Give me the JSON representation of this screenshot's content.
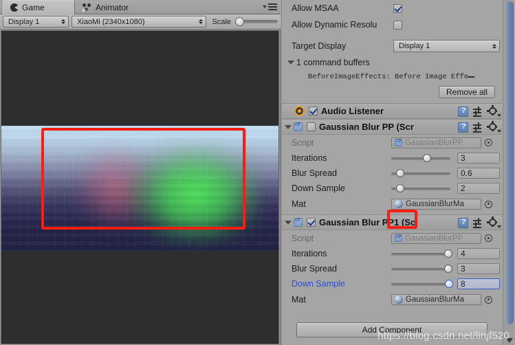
{
  "game_view": {
    "tabs": [
      {
        "label": "Game",
        "icon": "game-icon",
        "active": true
      },
      {
        "label": "Animator",
        "icon": "animator-icon",
        "active": false
      }
    ],
    "menu_icon": "hamburger-menu-icon",
    "toolbar": {
      "display_dropdown": "Display 1",
      "aspect_dropdown": "XiaoMi (2340x1080)",
      "scale_label": "Scale",
      "scale_value": 1
    }
  },
  "inspector": {
    "camera_props": {
      "allow_msaa_label": "Allow MSAA",
      "allow_msaa_checked": true,
      "allow_dynamic_label": "Allow Dynamic Resolu",
      "allow_dynamic_checked": false,
      "target_display_label": "Target Display",
      "target_display_value": "Display 1",
      "command_buffers_label": "1 command buffers",
      "command_buffer_entry": "BeforeImageEffects: Before Image Effect - C",
      "remove_all_label": "Remove all"
    },
    "components": [
      {
        "title": "Audio Listener",
        "icon": "audio-listener-icon",
        "enabled": true,
        "foldout_open": false
      },
      {
        "title": "Gaussian Blur PP (Scr",
        "icon": "cs-script-icon",
        "enabled": false,
        "foldout_open": true,
        "fields": {
          "script_label": "Script",
          "script_value": "GaussianBlurPP",
          "mat_label": "Mat",
          "mat_value": "GaussianBlurMa"
        },
        "sliders": [
          {
            "label": "Iterations",
            "value": "3",
            "pct": 60,
            "focused": false,
            "label_highlight": false
          },
          {
            "label": "Blur Spread",
            "value": "0.6",
            "pct": 15,
            "focused": false,
            "label_highlight": false
          },
          {
            "label": "Down Sample",
            "value": "2",
            "pct": 15,
            "focused": false,
            "label_highlight": false
          }
        ]
      },
      {
        "title_parts": {
          "before": "Gaussian Blur ",
          "highlight": "PP1",
          "after": " (Sc"
        },
        "title": "Gaussian Blur PP1 (Sc",
        "icon": "cs-script-icon",
        "enabled": true,
        "foldout_open": true,
        "fields": {
          "script_label": "Script",
          "script_value": "GaussianBlurPP",
          "mat_label": "Mat",
          "mat_value": "GaussianBlurMa"
        },
        "sliders": [
          {
            "label": "Iterations",
            "value": "4",
            "pct": 96,
            "focused": false,
            "label_highlight": false
          },
          {
            "label": "Blur Spread",
            "value": "3",
            "pct": 96,
            "focused": false,
            "label_highlight": false
          },
          {
            "label": "Down Sample",
            "value": "8",
            "pct": 98,
            "focused": true,
            "label_highlight": true
          }
        ]
      }
    ],
    "add_component_label": "Add Component"
  },
  "annotations": {
    "color": "#fa1e12",
    "game_box": "red-rectangle-game-region",
    "pp1_box": "red-rectangle-pp1-name"
  },
  "watermark": "https://blog.csdn.net/linjf520"
}
